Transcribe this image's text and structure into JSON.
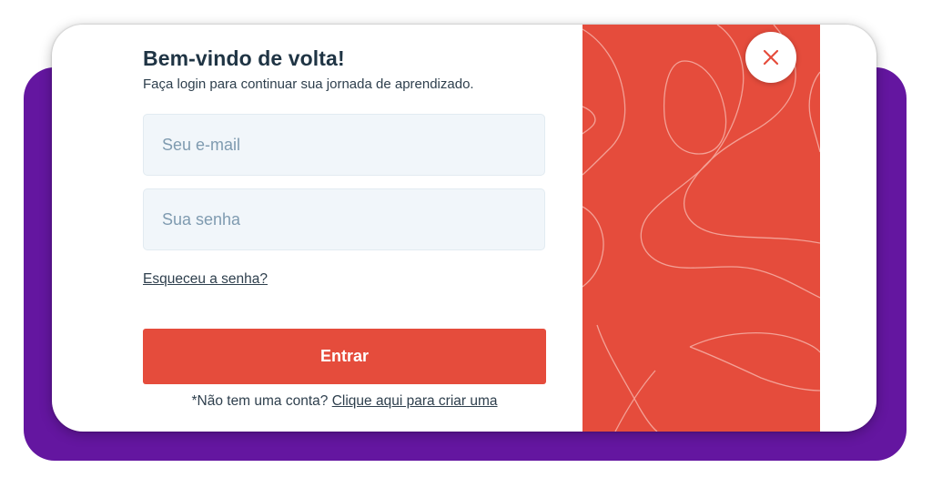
{
  "login": {
    "title": "Bem-vindo de volta!",
    "subtitle": "Faça login para continuar sua jornada de aprendizado.",
    "email_placeholder": "Seu e-mail",
    "email_value": "",
    "password_placeholder": "Sua senha",
    "password_value": "",
    "forgot_password_label": "Esqueceu a senha?",
    "submit_label": "Entrar",
    "signup_prompt": "*Não tem uma conta?",
    "signup_link_label": "Clique aqui para criar uma"
  },
  "icons": {
    "close": "close-icon",
    "decoration": "topographic-pattern"
  },
  "colors": {
    "accent": "#e54c3c",
    "backdrop": "#6416a0",
    "input_background": "#f1f6fa",
    "title_text": "#1f3444",
    "placeholder_text": "#7f9bb0"
  }
}
